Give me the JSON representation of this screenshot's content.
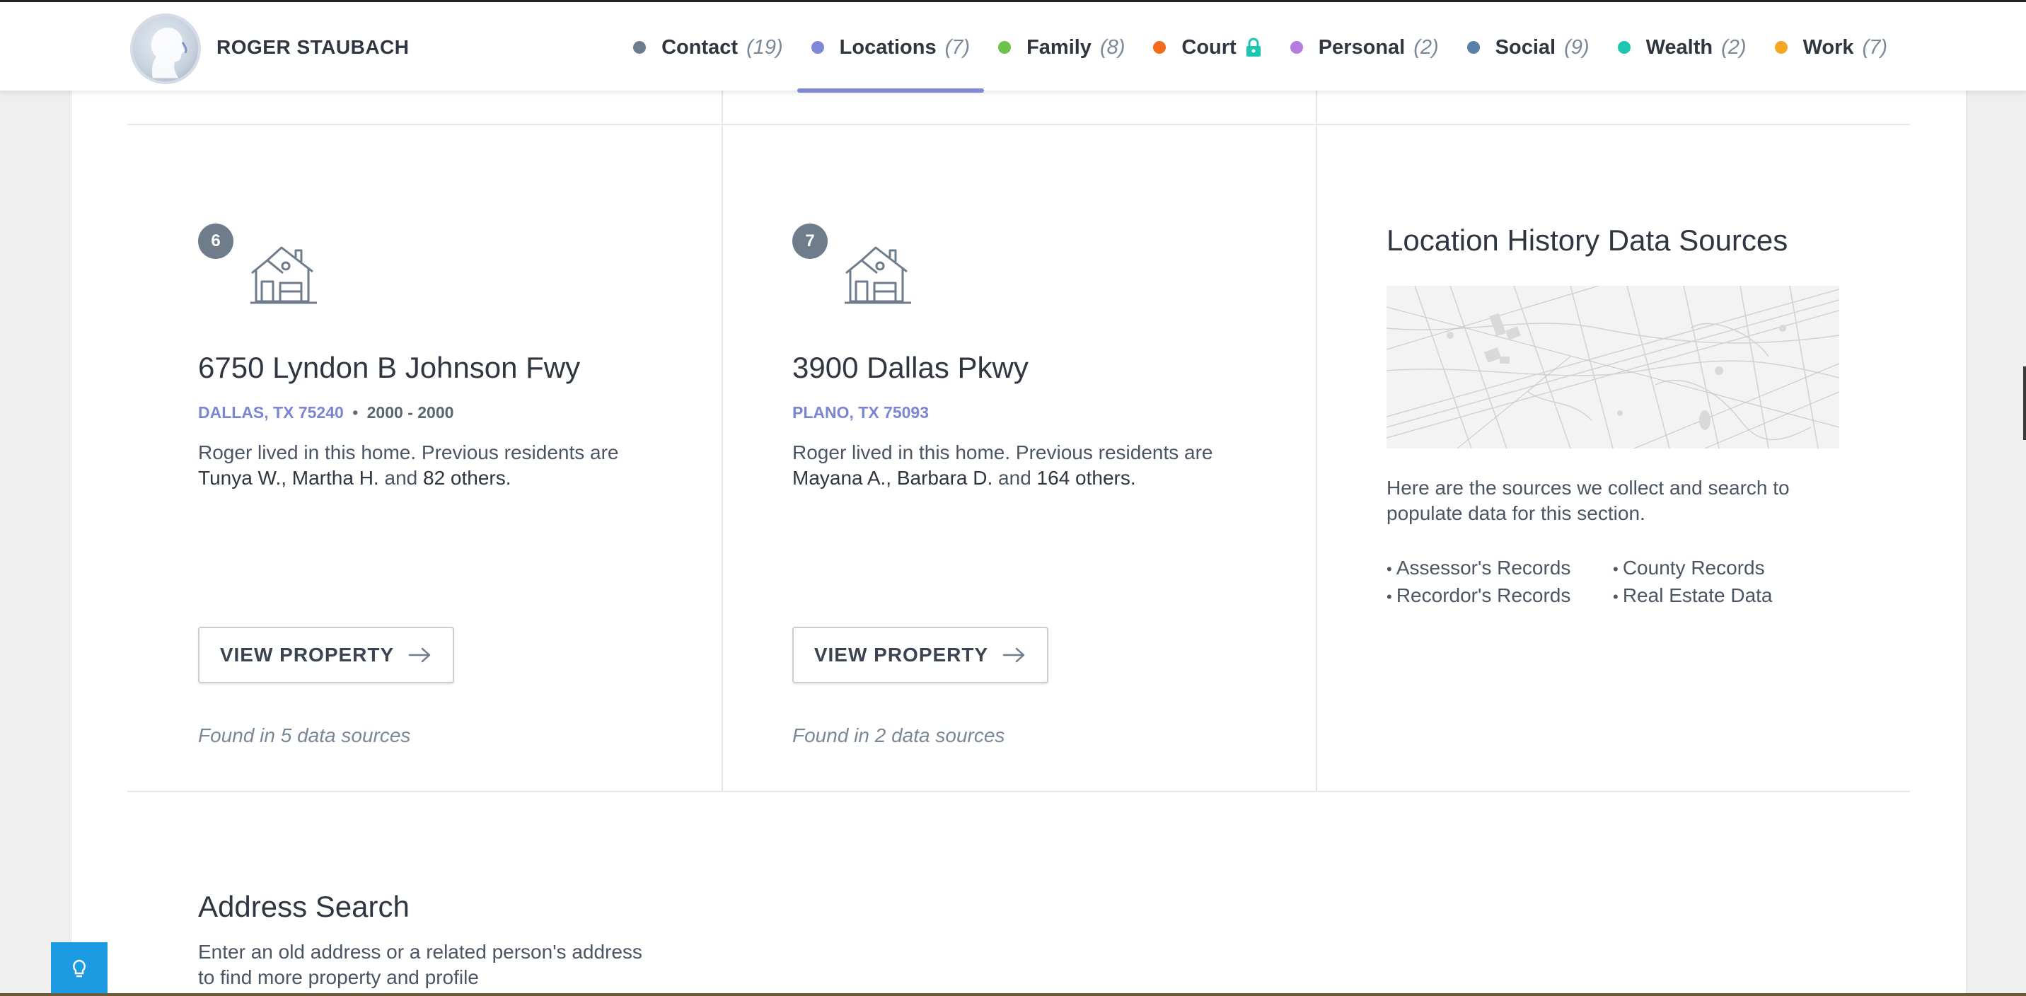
{
  "header": {
    "name": "ROGER STAUBACH",
    "nav": [
      {
        "label": "Contact",
        "count": "(19)",
        "color": "#6f7c8b",
        "active": false
      },
      {
        "label": "Locations",
        "count": "(7)",
        "color": "#7f87d8",
        "active": true
      },
      {
        "label": "Family",
        "count": "(8)",
        "color": "#6cc24a",
        "active": false
      },
      {
        "label": "Court",
        "count": "",
        "color": "#f26b1d",
        "active": false,
        "icon": "lock-icon"
      },
      {
        "label": "Personal",
        "count": "(2)",
        "color": "#b57bdf",
        "active": false
      },
      {
        "label": "Social",
        "count": "(9)",
        "color": "#5b7fa8",
        "active": false
      },
      {
        "label": "Wealth",
        "count": "(2)",
        "color": "#1cc6b0",
        "active": false
      },
      {
        "label": "Work",
        "count": "(7)",
        "color": "#f5a623",
        "active": false
      }
    ]
  },
  "properties": [
    {
      "index": "6",
      "address": "6750 Lyndon B Johnson Fwy",
      "city": "DALLAS, TX 75240",
      "separator": "•",
      "years": "2000 - 2000",
      "desc_prefix": "Roger lived in this home. Previous residents are ",
      "residents": "Tunya W., Martha H.",
      "desc_join": " and ",
      "others": "82 others.",
      "button": "VIEW PROPERTY",
      "found": "Found in 5 data sources"
    },
    {
      "index": "7",
      "address": "3900 Dallas Pkwy",
      "city": "PLANO, TX 75093",
      "separator": "",
      "years": "",
      "desc_prefix": "Roger lived in this home. Previous residents are ",
      "residents": "Mayana A., Barbara D.",
      "desc_join": " and ",
      "others": "164 others.",
      "button": "VIEW PROPERTY",
      "found": "Found in 2 data sources"
    }
  ],
  "sources": {
    "title": "Location History Data Sources",
    "text": "Here are the sources we collect and search to populate data for this section.",
    "items": [
      "Assessor's Records",
      "County Records",
      "Recordor's Records",
      "Real Estate Data"
    ]
  },
  "address_search": {
    "title": "Address Search",
    "text": "Enter an old address or a related person's address to find more property and profile"
  }
}
